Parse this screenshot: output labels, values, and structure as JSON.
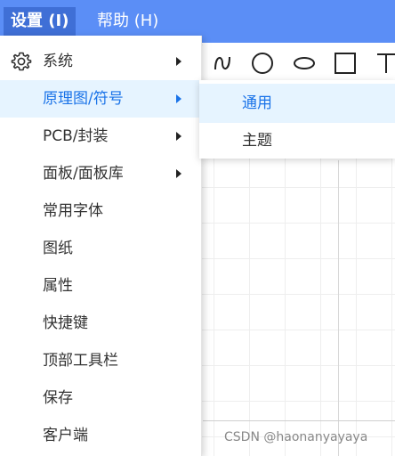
{
  "menubar": {
    "settings_label": "设置 (I)",
    "help_label": "帮助 (H)"
  },
  "dropdown": {
    "items": [
      {
        "label": "系统",
        "icon": "gear-icon",
        "submenu": true
      },
      {
        "label": "原理图/符号",
        "submenu": true,
        "highlighted": true
      },
      {
        "label": "PCB/封装",
        "submenu": true
      },
      {
        "label": "面板/面板库",
        "submenu": true
      },
      {
        "label": "常用字体"
      },
      {
        "label": "图纸"
      },
      {
        "label": "属性"
      },
      {
        "label": "快捷键"
      },
      {
        "label": "顶部工具栏"
      },
      {
        "label": "保存"
      },
      {
        "label": "客户端"
      }
    ]
  },
  "submenu": {
    "items": [
      {
        "label": "通用",
        "highlighted": true
      },
      {
        "label": "主题"
      }
    ]
  },
  "toolbar": {
    "tools": [
      "curve-tool-icon",
      "circle-tool-icon",
      "ellipse-tool-icon",
      "rectangle-tool-icon",
      "text-tool-icon"
    ]
  },
  "watermark": "CSDN @haonanyayaya",
  "colors": {
    "menubar": "#5b8ef6",
    "highlight_bg": "#e6f4ff",
    "highlight_text": "#1a73e8"
  }
}
